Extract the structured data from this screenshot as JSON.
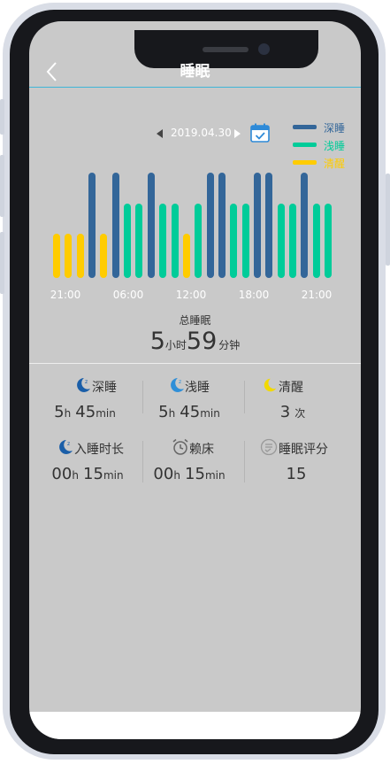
{
  "header": {
    "title": "睡眠"
  },
  "date": "2019.04.30",
  "legend": [
    {
      "label": "深睡",
      "color": "#336699"
    },
    {
      "label": "浅睡",
      "color": "#00cc99"
    },
    {
      "label": "清醒",
      "color": "#ffcc00"
    }
  ],
  "chart_data": {
    "type": "bar",
    "x_ticks": [
      "21:00",
      "06:00",
      "12:00",
      "18:00",
      "21:00"
    ],
    "levels": {
      "清醒": 1,
      "浅睡": 2,
      "深睡": 3
    },
    "series": [
      "清醒",
      "清醒",
      "清醒",
      "深睡",
      "清醒",
      "深睡",
      "浅睡",
      "浅睡",
      "深睡",
      "浅睡",
      "浅睡",
      "清醒",
      "浅睡",
      "深睡",
      "深睡",
      "浅睡",
      "浅睡",
      "深睡",
      "深睡",
      "浅睡",
      "浅睡",
      "深睡",
      "浅睡",
      "浅睡"
    ]
  },
  "total": {
    "title": "总睡眠",
    "hours": "5",
    "hours_unit": "小时",
    "minutes": "59",
    "minutes_unit": "分钟"
  },
  "stats": {
    "deep": {
      "label": "深睡",
      "h": "5",
      "h_unit": "h",
      "m": "45",
      "m_unit": "min"
    },
    "light": {
      "label": "浅睡",
      "h": "5",
      "h_unit": "h",
      "m": "45",
      "m_unit": "min"
    },
    "awake": {
      "label": "清醒",
      "count": "3",
      "count_unit": "次"
    },
    "fall_asleep": {
      "label": "入睡时长",
      "h": "00",
      "h_unit": "h",
      "m": "15",
      "m_unit": "min"
    },
    "lie_in": {
      "label": "赖床",
      "h": "00",
      "h_unit": "h",
      "m": "15",
      "m_unit": "min"
    },
    "score": {
      "label": "睡眠评分",
      "value": "15"
    }
  }
}
